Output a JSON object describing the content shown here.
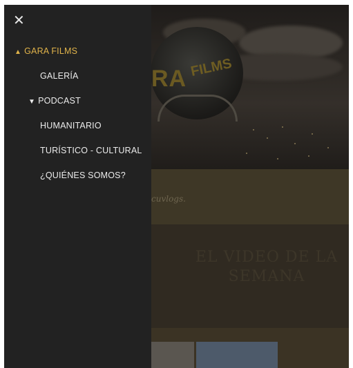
{
  "menu": {
    "close_icon": "close-icon",
    "items": [
      {
        "label": "GARA FILMS",
        "icon": "chevron-up-icon",
        "active": true
      },
      {
        "label": "GALERÍA"
      },
      {
        "label": "PODCAST",
        "icon": "chevron-down-icon"
      },
      {
        "label": "HUMANITARIO"
      },
      {
        "label": "TURÍSTICO - CULTURAL"
      },
      {
        "label": "¿QUIÉNES SOMOS?"
      }
    ],
    "active_color": "#e0b34a",
    "background_color": "#222222"
  },
  "page": {
    "logo_text_1": "RA",
    "logo_text_2": "FILMS",
    "band_text": "cuvlogs.",
    "video_title_line1": "EL VIDEO DE LA",
    "video_title_line2": "SEMANA"
  }
}
